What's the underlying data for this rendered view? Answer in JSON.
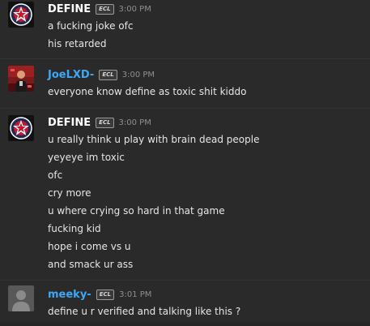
{
  "messages": [
    {
      "username": "DEFINE",
      "badge": "ECL",
      "time": "3:00 PM",
      "lines": [
        "a fucking joke ofc",
        "his retarded"
      ]
    },
    {
      "username": "JoeLXD-",
      "badge": "ECL",
      "time": "3:00 PM",
      "lines": [
        "everyone know define as toxic shit kiddo"
      ]
    },
    {
      "username": "DEFINE",
      "badge": "ECL",
      "time": "3:00 PM",
      "lines": [
        "u really think u play with brain dead people",
        "yeyeye im toxic",
        "ofc",
        "cry more",
        "u where crying so hard in that game",
        "fucking kid",
        "hope i come vs u",
        "and smack ur ass"
      ]
    },
    {
      "username": "meeky-",
      "badge": "ECL",
      "time": "3:01 PM",
      "lines": [
        "define u r verified and talking like this ?"
      ]
    }
  ],
  "colors": {
    "background": "#2a2a2a",
    "username_default": "#ffffff",
    "username_highlight": "#3da8f5",
    "message_text": "#e6e6e6",
    "timestamp": "#8f8f8f"
  },
  "avatars": [
    "star-logo-avatar",
    "red-player-photo-avatar",
    "star-logo-avatar",
    "default-user-avatar"
  ]
}
